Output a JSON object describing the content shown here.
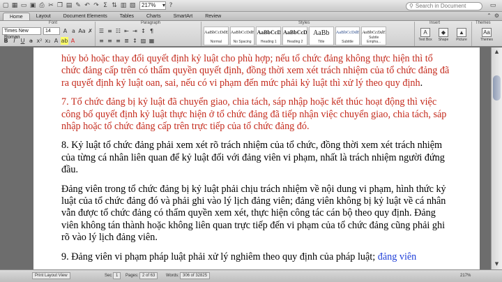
{
  "toolbar": {
    "zoom": "217%",
    "search_placeholder": "Search in Document"
  },
  "tabs": [
    "Home",
    "Layout",
    "Document Elements",
    "Tables",
    "Charts",
    "SmartArt",
    "Review"
  ],
  "ribbon": {
    "group_font": "Font",
    "group_paragraph": "Paragraph",
    "group_styles": "Styles",
    "group_insert": "Insert",
    "group_themes": "Themes",
    "font_name": "Times New Roman",
    "font_size": "14",
    "styles": [
      {
        "preview": "AaBbCcDdEe",
        "name": "Normal"
      },
      {
        "preview": "AaBbCcDdEe",
        "name": "No Spacing"
      },
      {
        "preview": "AaBbCcDe",
        "name": "Heading 1"
      },
      {
        "preview": "AaBbCcDe",
        "name": "Heading 2"
      },
      {
        "preview": "AaBb",
        "name": "Title"
      },
      {
        "preview": "AaBbCcDdEe",
        "name": "Subtitle"
      },
      {
        "preview": "AaBbCcDdEe",
        "name": "Subtle Empha..."
      }
    ],
    "insert_items": [
      "Text Box",
      "Shape",
      "Picture"
    ],
    "themes_label": "Themes"
  },
  "document": {
    "p1": "hủy bỏ hoặc thay đổi quyết định kỷ luật cho phù hợp; nếu tổ chức đảng không thực hiện thì tổ chức đảng cấp trên có thẩm quyền quyết định, đồng thời xem xét trách nhiệm của tổ chức đảng đã ra quyết định kỷ luật oan, sai, nếu có vi phạm đến mức phải kỷ luật thì xử lý theo quy định",
    "p1_end": ".",
    "p2": "7. Tổ chức đảng bị kỷ luật đã chuyển giao, chia tách, sáp nhập hoặc kết thúc hoạt động thì việc công bố quyết định kỷ luật thực hiện ở tổ chức đảng đã tiếp nhận việc chuyển giao, chia tách, sáp nhập hoặc tổ chức đảng cấp trên trực tiếp của tổ chức đảng đó.",
    "p3": "8. Kỷ luật tổ chức đảng phải xem xét rõ trách nhiệm của tổ chức, đồng thời xem xét trách nhiệm của từng cá nhân liên quan để kỷ luật đối với đảng viên vi phạm, nhất là trách nhiệm người đứng đầu.",
    "p4": "Đảng viên trong tổ chức đảng bị kỷ luật phải chịu trách nhiệm về nội dung vi phạm, hình thức kỷ luật của tổ chức đảng đó và phải ghi vào lý lịch đảng viên; đảng viên không bị kỷ luật về cá nhân vẫn được tổ chức đảng có thẩm quyền xem xét, thực hiện công tác cán bộ theo quy định. Đảng viên không tán thành hoặc không liên quan trực tiếp đến vi phạm của tổ chức đảng cũng phải ghi rõ vào lý lịch đảng viên.",
    "p5": "9. Đảng viên vi phạm pháp luật phải xử lý nghiêm theo quy định của pháp luật;",
    "p5_link": "đảng viên"
  },
  "status": {
    "view": "Print Layout View",
    "sec": "Sec",
    "sec_val": "1",
    "pages_label": "Pages:",
    "pages_val": "2 of 63",
    "words_label": "Words:",
    "words_val": "306 of 32825",
    "zoom": "217%"
  },
  "colors": {
    "red_text": "#c42a1c",
    "blue_text": "#1f3fd8"
  }
}
